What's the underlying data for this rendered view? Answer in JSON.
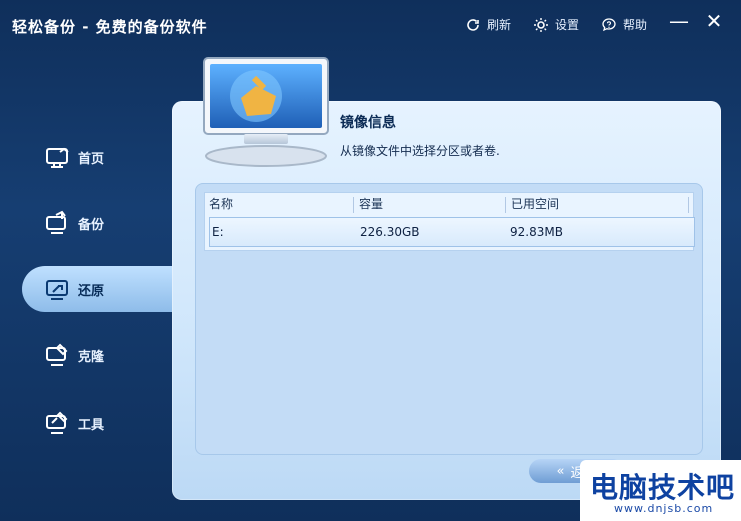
{
  "app": {
    "title": "轻松备份 - 免费的备份软件"
  },
  "top_actions": [
    {
      "label": "刷新",
      "icon": "refresh-icon"
    },
    {
      "label": "设置",
      "icon": "gear-icon"
    },
    {
      "label": "帮助",
      "icon": "help-icon"
    }
  ],
  "window": {
    "minimize": "—",
    "close": "✕"
  },
  "sidebar": {
    "items": [
      {
        "label": "首页",
        "icon": "home-icon"
      },
      {
        "label": "备份",
        "icon": "backup-icon"
      },
      {
        "label": "还原",
        "icon": "restore-icon",
        "active": true
      },
      {
        "label": "克隆",
        "icon": "clone-icon"
      },
      {
        "label": "工具",
        "icon": "tools-icon"
      }
    ]
  },
  "content": {
    "title": "镜像信息",
    "subtitle": "从镜像文件中选择分区或者卷.",
    "table": {
      "headers": [
        "名称",
        "容量",
        "已用空间"
      ],
      "rows": [
        [
          "E:",
          "226.30GB",
          "92.83MB"
        ]
      ]
    }
  },
  "footer": {
    "back_label": "返回"
  },
  "watermark": {
    "main": "电脑技术吧",
    "sub": "www.dnjsb.com"
  },
  "colors": {
    "accent": "#0f2f5b",
    "panel": "#cfe6fb"
  }
}
